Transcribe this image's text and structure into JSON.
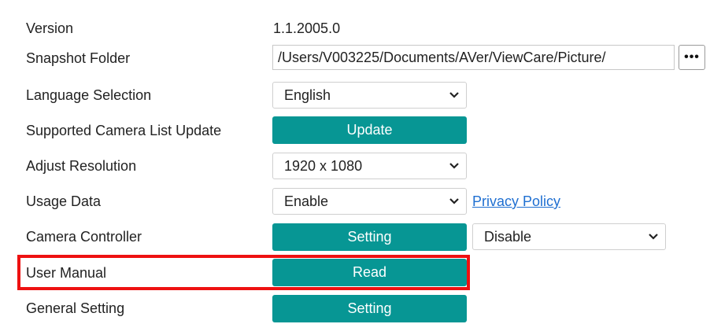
{
  "rows": {
    "version": {
      "label": "Version",
      "value": "1.1.2005.0"
    },
    "snapshot_folder": {
      "label": "Snapshot Folder",
      "value": "/Users/V003225/Documents/AVer/ViewCare/Picture/",
      "browse_label": "•••"
    },
    "language": {
      "label": "Language Selection",
      "selected": "English"
    },
    "camera_list": {
      "label": "Supported Camera List Update",
      "button": "Update"
    },
    "resolution": {
      "label": "Adjust Resolution",
      "selected": "1920 x 1080"
    },
    "usage_data": {
      "label": "Usage Data",
      "selected": "Enable",
      "link": "Privacy Policy"
    },
    "camera_controller": {
      "label": "Camera Controller",
      "button": "Setting",
      "selected": "Disable"
    },
    "user_manual": {
      "label": "User Manual",
      "button": "Read"
    },
    "general_setting": {
      "label": "General Setting",
      "button": "Setting"
    }
  },
  "colors": {
    "button": "#079694",
    "link": "#1f6fd1",
    "highlight": "#ee1111"
  },
  "icons": {
    "dropdown": "chevron-down-icon",
    "browse": "more-horizontal-icon"
  }
}
